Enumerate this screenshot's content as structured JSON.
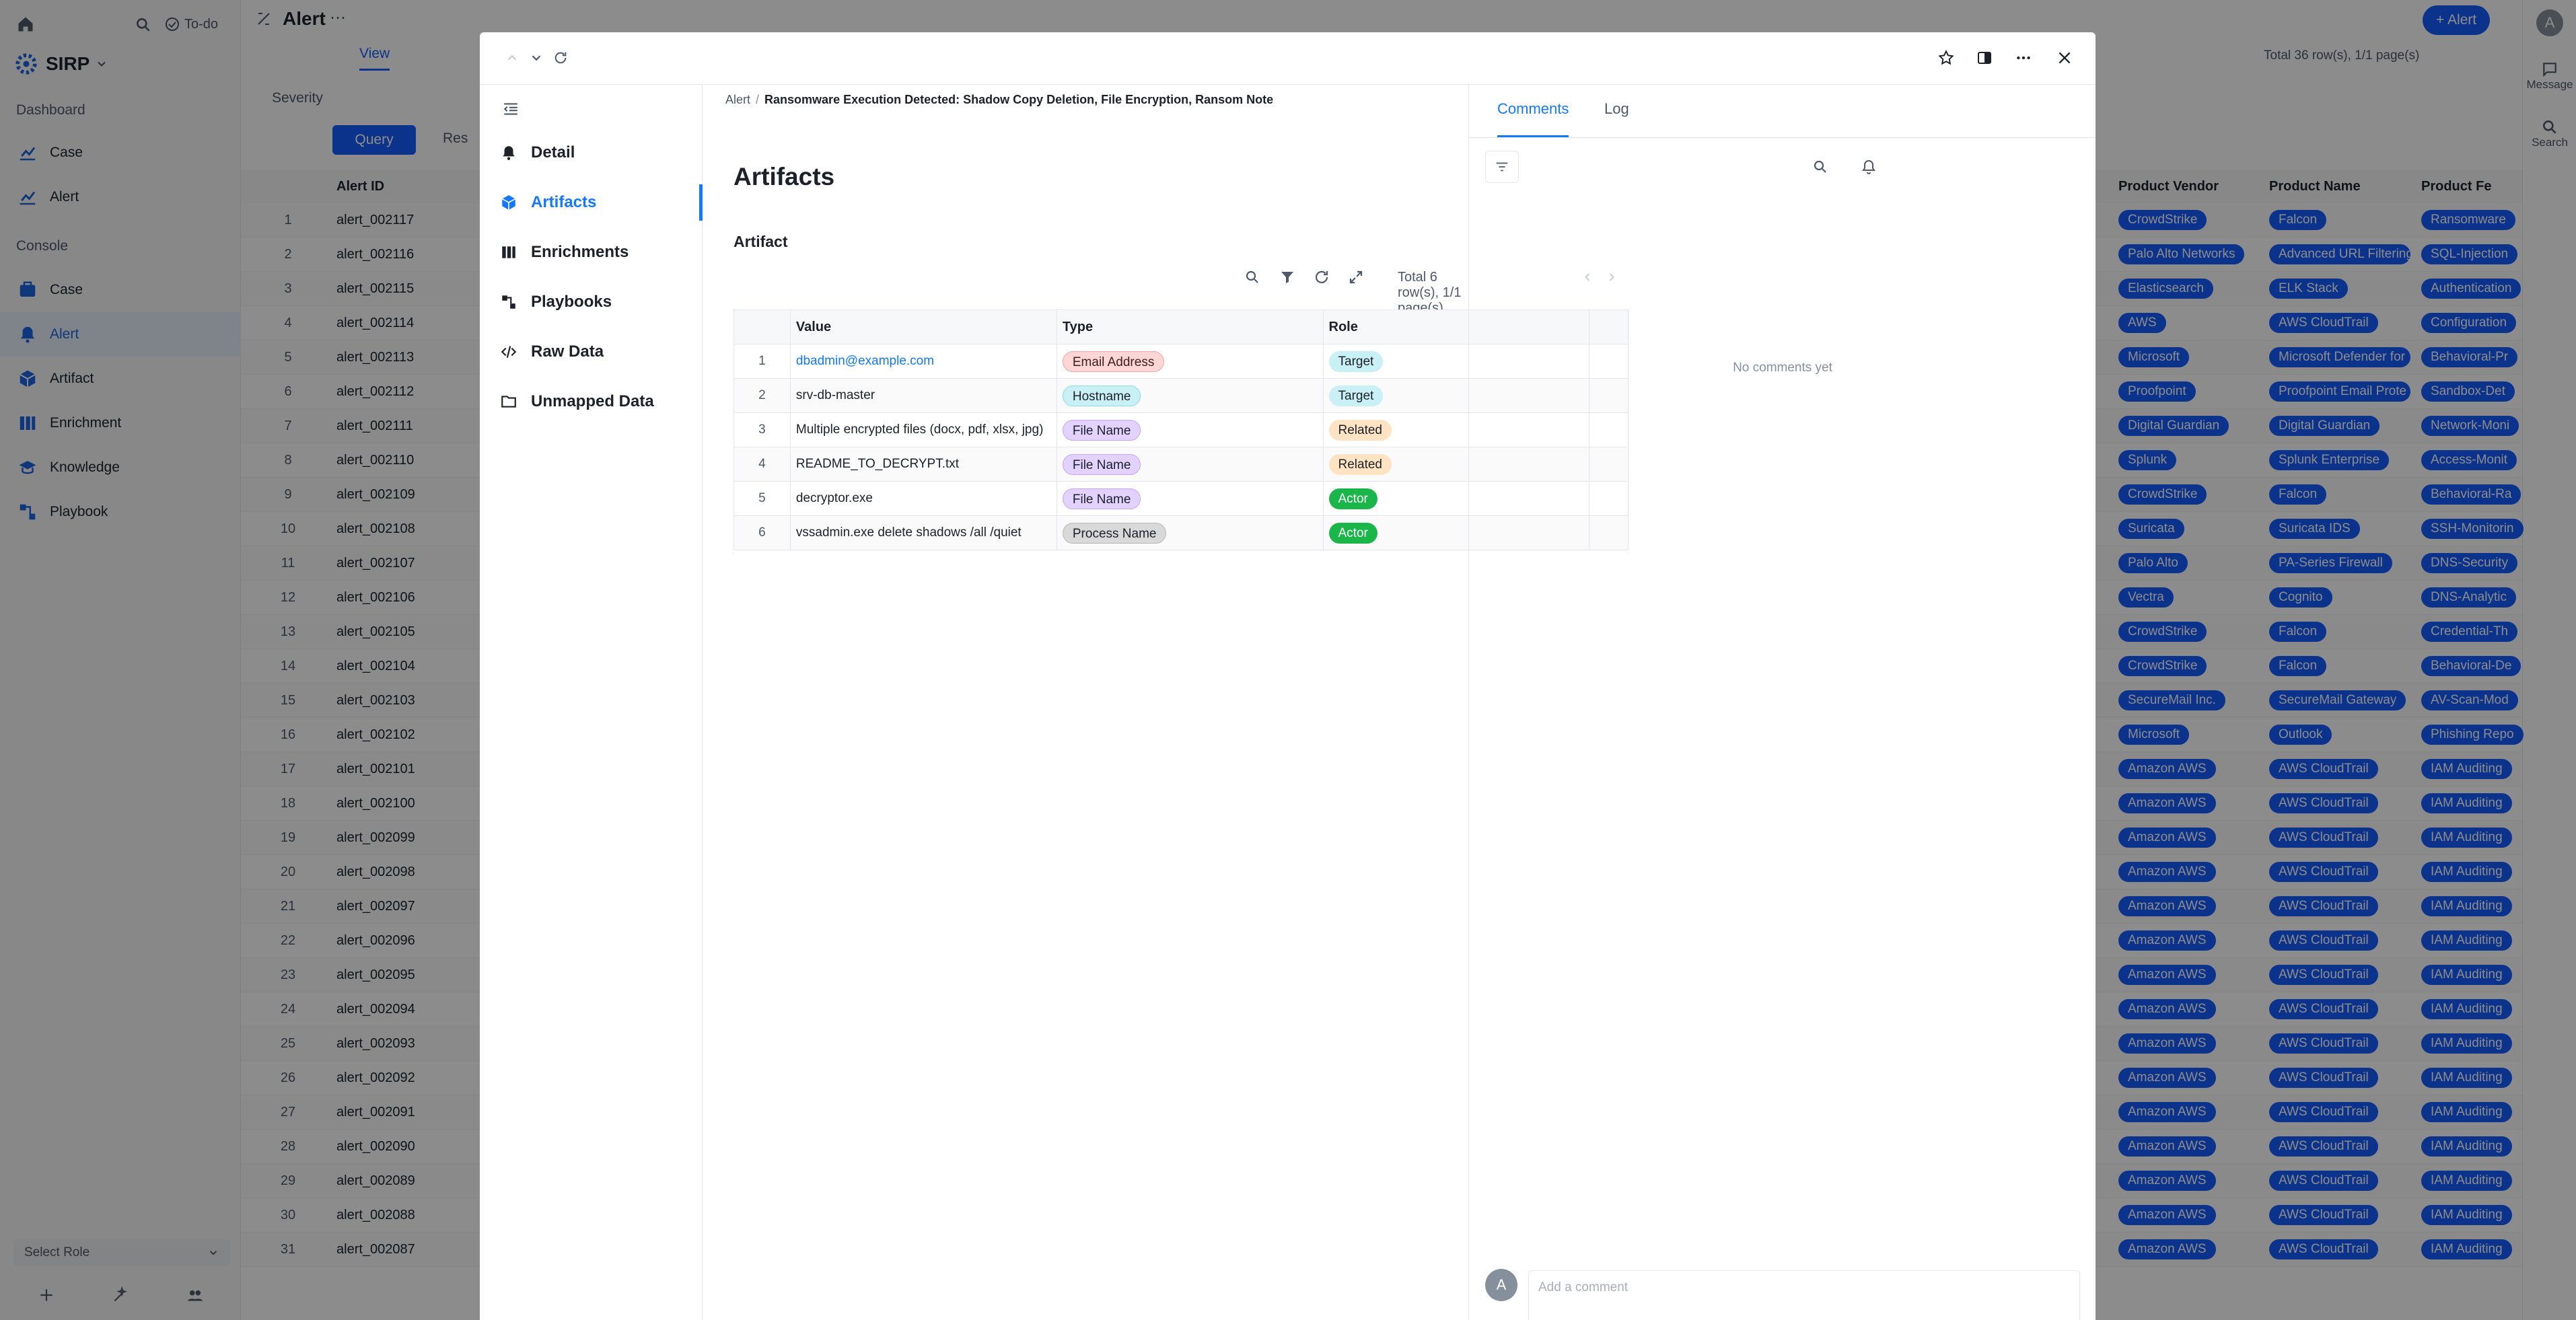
{
  "app": {
    "name": "SIRP",
    "todo_label": "To-do",
    "select_role": "Select Role",
    "sections": {
      "dashboard": "Dashboard",
      "console": "Console"
    },
    "dashboard_items": [
      {
        "label": "Case",
        "icon": "chart-icon"
      },
      {
        "label": "Alert",
        "icon": "chart-icon"
      }
    ],
    "console_items": [
      {
        "label": "Case",
        "icon": "case-icon"
      },
      {
        "label": "Alert",
        "icon": "alert-icon"
      },
      {
        "label": "Artifact",
        "icon": "cube-icon"
      },
      {
        "label": "Enrichment",
        "icon": "columns-icon"
      },
      {
        "label": "Knowledge",
        "icon": "graduation-icon"
      },
      {
        "label": "Playbook",
        "icon": "playbook-icon"
      }
    ],
    "accent": "#1d64e0"
  },
  "background_page": {
    "title": "Alert",
    "view_tab": "View",
    "severity_label": "Severity",
    "query_button": "Query",
    "reset_button": "Res",
    "new_alert_button": "+ Alert",
    "total_label": "Total 36 row(s), 1/1 page(s)",
    "right_rail": {
      "message": "Message",
      "search": "Search",
      "avatar": "A"
    },
    "columns": {
      "alert_id": "Alert ID",
      "product_vendor": "Product Vendor",
      "product_name": "Product Name",
      "product_feature": "Product Fe"
    },
    "rows": [
      {
        "n": "1",
        "id": "alert_002117",
        "vendor": "CrowdStrike",
        "product": "Falcon",
        "feature": "Ransomware"
      },
      {
        "n": "2",
        "id": "alert_002116",
        "vendor": "Palo Alto Networks",
        "product": "Advanced URL Filtering",
        "feature": "SQL-Injection"
      },
      {
        "n": "3",
        "id": "alert_002115",
        "vendor": "Elasticsearch",
        "product": "ELK Stack",
        "feature": "Authentication"
      },
      {
        "n": "4",
        "id": "alert_002114",
        "vendor": "AWS",
        "product": "AWS CloudTrail",
        "feature": "Configuration"
      },
      {
        "n": "5",
        "id": "alert_002113",
        "vendor": "Microsoft",
        "product": "Microsoft Defender for",
        "feature": "Behavioral-Pr"
      },
      {
        "n": "6",
        "id": "alert_002112",
        "vendor": "Proofpoint",
        "product": "Proofpoint Email Prote",
        "feature": "Sandbox-Det"
      },
      {
        "n": "7",
        "id": "alert_002111",
        "vendor": "Digital Guardian",
        "product": "Digital Guardian",
        "feature": "Network-Moni"
      },
      {
        "n": "8",
        "id": "alert_002110",
        "vendor": "Splunk",
        "product": "Splunk Enterprise",
        "feature": "Access-Monit"
      },
      {
        "n": "9",
        "id": "alert_002109",
        "vendor": "CrowdStrike",
        "product": "Falcon",
        "feature": "Behavioral-Ra"
      },
      {
        "n": "10",
        "id": "alert_002108",
        "vendor": "Suricata",
        "product": "Suricata IDS",
        "feature": "SSH-Monitorin"
      },
      {
        "n": "11",
        "id": "alert_002107",
        "vendor": "Palo Alto",
        "product": "PA-Series Firewall",
        "feature": "DNS-Security"
      },
      {
        "n": "12",
        "id": "alert_002106",
        "vendor": "Vectra",
        "product": "Cognito",
        "feature": "DNS-Analytic"
      },
      {
        "n": "13",
        "id": "alert_002105",
        "vendor": "CrowdStrike",
        "product": "Falcon",
        "feature": "Credential-Th"
      },
      {
        "n": "14",
        "id": "alert_002104",
        "vendor": "CrowdStrike",
        "product": "Falcon",
        "feature": "Behavioral-De"
      },
      {
        "n": "15",
        "id": "alert_002103",
        "vendor": "SecureMail Inc.",
        "product": "SecureMail Gateway",
        "feature": "AV-Scan-Mod"
      },
      {
        "n": "16",
        "id": "alert_002102",
        "vendor": "Microsoft",
        "product": "Outlook",
        "feature": "Phishing Repo"
      },
      {
        "n": "17",
        "id": "alert_002101",
        "vendor": "Amazon AWS",
        "product": "AWS CloudTrail",
        "feature": "IAM Auditing"
      },
      {
        "n": "18",
        "id": "alert_002100",
        "vendor": "Amazon AWS",
        "product": "AWS CloudTrail",
        "feature": "IAM Auditing"
      },
      {
        "n": "19",
        "id": "alert_002099",
        "vendor": "Amazon AWS",
        "product": "AWS CloudTrail",
        "feature": "IAM Auditing"
      },
      {
        "n": "20",
        "id": "alert_002098",
        "vendor": "Amazon AWS",
        "product": "AWS CloudTrail",
        "feature": "IAM Auditing"
      },
      {
        "n": "21",
        "id": "alert_002097",
        "vendor": "Amazon AWS",
        "product": "AWS CloudTrail",
        "feature": "IAM Auditing"
      },
      {
        "n": "22",
        "id": "alert_002096",
        "vendor": "Amazon AWS",
        "product": "AWS CloudTrail",
        "feature": "IAM Auditing"
      },
      {
        "n": "23",
        "id": "alert_002095",
        "vendor": "Amazon AWS",
        "product": "AWS CloudTrail",
        "feature": "IAM Auditing"
      },
      {
        "n": "24",
        "id": "alert_002094",
        "vendor": "Amazon AWS",
        "product": "AWS CloudTrail",
        "feature": "IAM Auditing"
      },
      {
        "n": "25",
        "id": "alert_002093",
        "vendor": "Amazon AWS",
        "product": "AWS CloudTrail",
        "feature": "IAM Auditing"
      },
      {
        "n": "26",
        "id": "alert_002092",
        "vendor": "Amazon AWS",
        "product": "AWS CloudTrail",
        "feature": "IAM Auditing"
      },
      {
        "n": "27",
        "id": "alert_002091",
        "vendor": "Amazon AWS",
        "product": "AWS CloudTrail",
        "feature": "IAM Auditing"
      },
      {
        "n": "28",
        "id": "alert_002090",
        "vendor": "Amazon AWS",
        "product": "AWS CloudTrail",
        "feature": "IAM Auditing"
      },
      {
        "n": "29",
        "id": "alert_002089",
        "vendor": "Amazon AWS",
        "product": "AWS CloudTrail",
        "feature": "IAM Auditing"
      },
      {
        "n": "30",
        "id": "alert_002088",
        "vendor": "Amazon AWS",
        "product": "AWS CloudTrail",
        "feature": "IAM Auditing"
      },
      {
        "n": "31",
        "id": "alert_002087",
        "vendor": "Amazon AWS",
        "product": "AWS CloudTrail",
        "feature": "IAM Auditing"
      }
    ]
  },
  "modal": {
    "breadcrumb": {
      "root": "Alert",
      "separator": "/",
      "current": "Ransomware Execution Detected: Shadow Copy Deletion, File Encryption, Ransom Note"
    },
    "nav": [
      {
        "label": "Detail",
        "icon": "bell-icon"
      },
      {
        "label": "Artifacts",
        "icon": "cube-icon"
      },
      {
        "label": "Enrichments",
        "icon": "columns-icon"
      },
      {
        "label": "Playbooks",
        "icon": "playbook-icon"
      },
      {
        "label": "Raw Data",
        "icon": "code-icon"
      },
      {
        "label": "Unmapped Data",
        "icon": "folder-icon"
      }
    ],
    "active_nav": "Artifacts",
    "page_title": "Artifacts",
    "section_title": "Artifact",
    "table_summary": "Total 6 row(s), 1/1 page(s)",
    "columns": [
      "Value",
      "Type",
      "Role"
    ],
    "rows": [
      {
        "n": "1",
        "value": "dbadmin@example.com",
        "type": "Email Address",
        "role": "Target"
      },
      {
        "n": "2",
        "value": "srv-db-master",
        "type": "Hostname",
        "role": "Target"
      },
      {
        "n": "3",
        "value": "Multiple encrypted files (docx, pdf, xlsx, jpg)",
        "type": "File Name",
        "role": "Related"
      },
      {
        "n": "4",
        "value": "README_TO_DECRYPT.txt",
        "type": "File Name",
        "role": "Related"
      },
      {
        "n": "5",
        "value": "decryptor.exe",
        "type": "File Name",
        "role": "Actor"
      },
      {
        "n": "6",
        "value": "vssadmin.exe delete shadows /all /quiet",
        "type": "Process Name",
        "role": "Actor"
      }
    ],
    "right_tabs": [
      "Comments",
      "Log"
    ],
    "empty_comments": "No comments yet",
    "comment_placeholder": "Add a comment",
    "user_avatar": "A"
  }
}
